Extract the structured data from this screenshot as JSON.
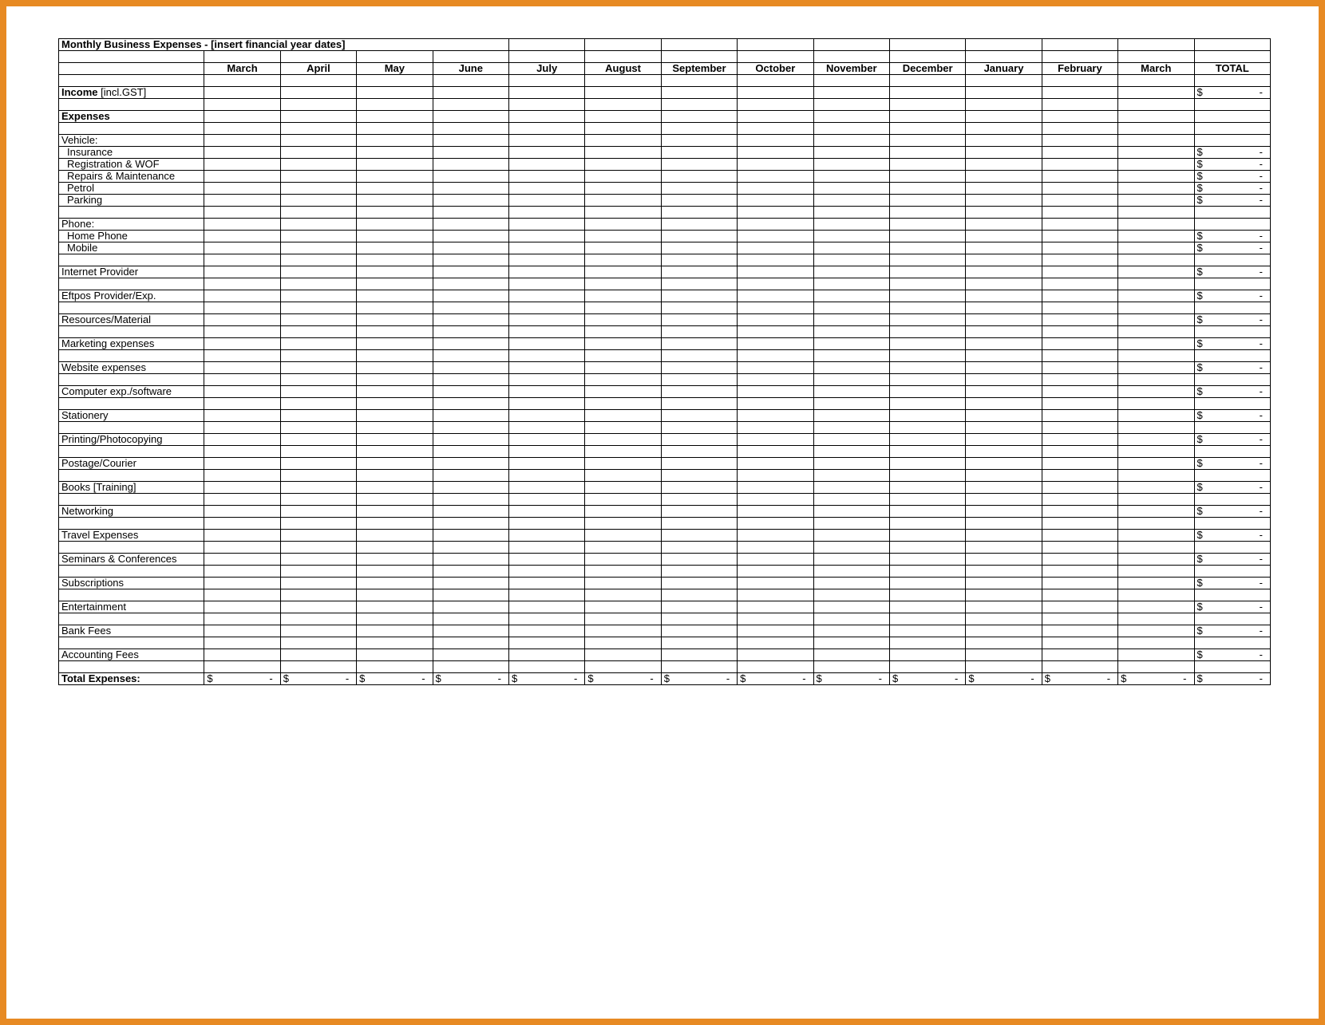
{
  "title": "Monthly Business Expenses - [insert financial year dates]",
  "months": [
    "March",
    "April",
    "May",
    "June",
    "July",
    "August",
    "September",
    "October",
    "November",
    "December",
    "January",
    "February",
    "March"
  ],
  "total_header": "TOTAL",
  "income_label_prefix": "Income",
  "income_label_suffix": " [incl.GST]",
  "expenses_label": "Expenses",
  "currency_symbol": "$",
  "dash": "-",
  "rows": [
    {
      "type": "section",
      "label": "Vehicle:",
      "total": false
    },
    {
      "type": "item",
      "label": "Insurance",
      "indent": true,
      "total": true
    },
    {
      "type": "item",
      "label": "Registration & WOF",
      "indent": true,
      "total": true
    },
    {
      "type": "item",
      "label": "Repairs & Maintenance",
      "indent": true,
      "total": true
    },
    {
      "type": "item",
      "label": "Petrol",
      "indent": true,
      "total": true
    },
    {
      "type": "item",
      "label": "Parking",
      "indent": true,
      "total": true
    },
    {
      "type": "blank"
    },
    {
      "type": "section",
      "label": "Phone:",
      "total": false
    },
    {
      "type": "item",
      "label": "Home Phone",
      "indent": true,
      "total": true
    },
    {
      "type": "item",
      "label": "Mobile",
      "indent": true,
      "total": true
    },
    {
      "type": "blank"
    },
    {
      "type": "item",
      "label": "Internet Provider",
      "total": true
    },
    {
      "type": "blank"
    },
    {
      "type": "item",
      "label": "Eftpos Provider/Exp.",
      "total": true
    },
    {
      "type": "blank"
    },
    {
      "type": "item",
      "label": "Resources/Material",
      "total": true
    },
    {
      "type": "blank"
    },
    {
      "type": "item",
      "label": "Marketing expenses",
      "total": true
    },
    {
      "type": "blank"
    },
    {
      "type": "item",
      "label": "Website expenses",
      "total": true
    },
    {
      "type": "blank"
    },
    {
      "type": "item",
      "label": "Computer exp./software",
      "total": true
    },
    {
      "type": "blank"
    },
    {
      "type": "item",
      "label": "Stationery",
      "total": true
    },
    {
      "type": "blank"
    },
    {
      "type": "item",
      "label": "Printing/Photocopying",
      "total": true
    },
    {
      "type": "blank"
    },
    {
      "type": "item",
      "label": "Postage/Courier",
      "total": true
    },
    {
      "type": "blank"
    },
    {
      "type": "item",
      "label": "Books [Training]",
      "total": true
    },
    {
      "type": "blank"
    },
    {
      "type": "item",
      "label": "Networking",
      "total": true
    },
    {
      "type": "blank"
    },
    {
      "type": "item",
      "label": "Travel Expenses",
      "total": true
    },
    {
      "type": "blank"
    },
    {
      "type": "item",
      "label": "Seminars & Conferences",
      "total": true
    },
    {
      "type": "blank"
    },
    {
      "type": "item",
      "label": "Subscriptions",
      "total": true
    },
    {
      "type": "blank"
    },
    {
      "type": "item",
      "label": "Entertainment",
      "total": true
    },
    {
      "type": "blank"
    },
    {
      "type": "item",
      "label": "Bank Fees",
      "total": true
    },
    {
      "type": "blank"
    },
    {
      "type": "item",
      "label": "Accounting Fees",
      "total": true
    },
    {
      "type": "blank"
    }
  ],
  "total_expenses_label": "Total Expenses:"
}
